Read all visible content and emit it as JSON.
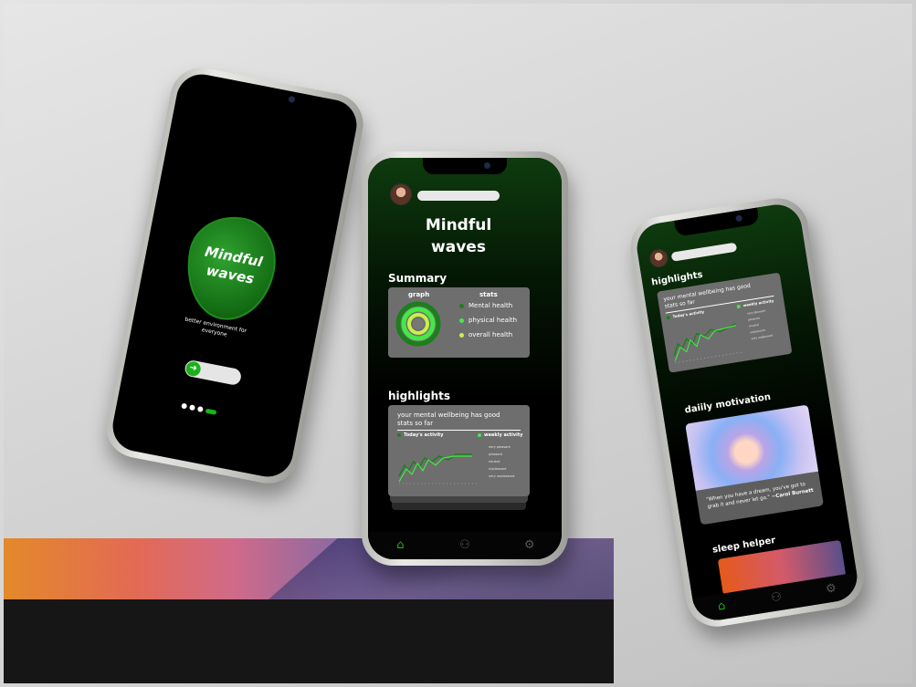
{
  "splash": {
    "title_line1": "Mindful",
    "title_line2": "waves",
    "tagline_line1": "better environment for",
    "tagline_line2": "everyone",
    "toggle_arrow": "➜"
  },
  "home": {
    "title_line1": "Mindful",
    "title_line2": "waves",
    "summary": {
      "heading": "Summary",
      "graph_label": "graph",
      "stats_label": "stats",
      "items": [
        {
          "label": "Mental health",
          "color": "#1e7e1e"
        },
        {
          "label": "physical health",
          "color": "#46e846"
        },
        {
          "label": "overall health",
          "color": "#c9f04a"
        }
      ]
    },
    "highlights": {
      "heading": "highlights",
      "text_line1": "your mental wellbeing has good",
      "text_line2": "stats so far",
      "today_label": "Today's activity",
      "weekly_label": "weekly activity",
      "legend": [
        "very pleasant",
        "pleasant",
        "neutral",
        "unpleasant",
        "very unpleasant"
      ]
    }
  },
  "detail": {
    "highlights": {
      "heading": "highlights",
      "text_line1": "your mental wellbeing has good",
      "text_line2": "stats so far",
      "today_label": "Today's activity",
      "weekly_label": "weekly activity",
      "legend": [
        "very pleasant",
        "pleasant",
        "neutral",
        "unpleasant",
        "very unpleasant"
      ]
    },
    "motivation": {
      "heading": "daiily motivation",
      "quote_line1": "\"When you have a dream, you've got to",
      "quote_line2": "grab it and never let go.\"",
      "author": "~Carol Burnett"
    },
    "sleep": {
      "heading": "sleep helper"
    }
  },
  "tabs": {
    "home_icon": "⌂",
    "community_icon": "⚇",
    "settings_icon": "⚙"
  },
  "colors": {
    "accent_green": "#1bb01b",
    "card_gray": "#6e6e6e"
  }
}
